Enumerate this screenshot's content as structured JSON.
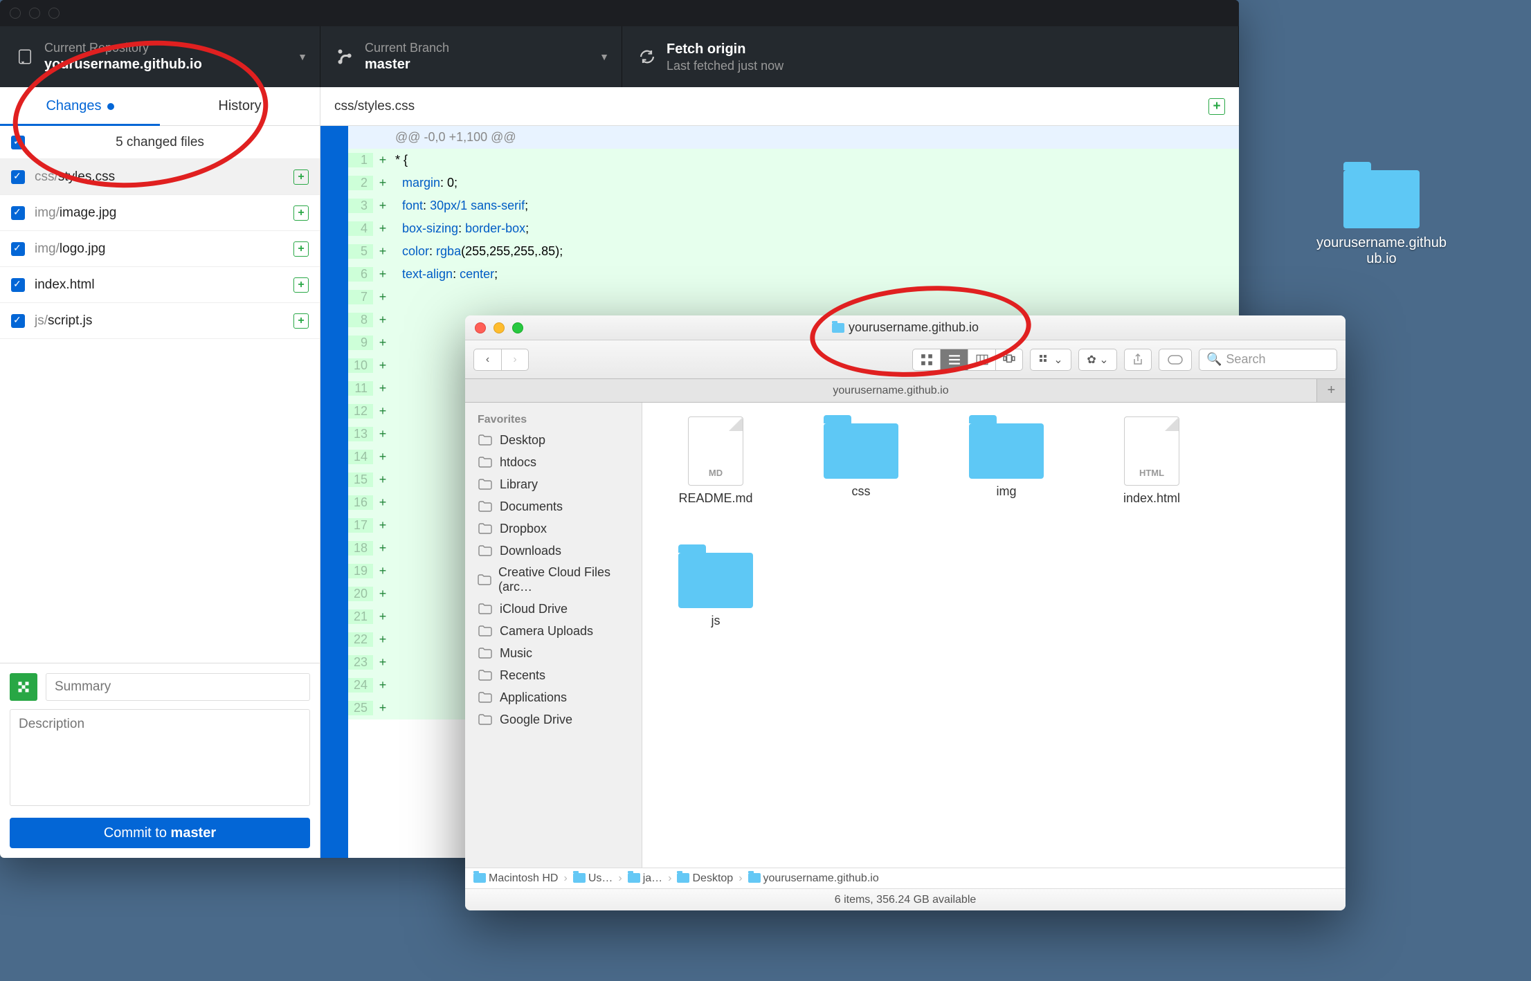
{
  "github": {
    "toolbar": {
      "repo_label": "Current Repository",
      "repo_value": "yourusername.github.io",
      "branch_label": "Current Branch",
      "branch_value": "master",
      "fetch_label": "Fetch origin",
      "fetch_sub": "Last fetched just now"
    },
    "tabs": {
      "changes": "Changes",
      "history": "History"
    },
    "file_count": "5 changed files",
    "files": [
      {
        "dir": "css/",
        "name": "styles.css",
        "selected": true
      },
      {
        "dir": "img/",
        "name": "image.jpg",
        "selected": false
      },
      {
        "dir": "img/",
        "name": "logo.jpg",
        "selected": false
      },
      {
        "dir": "",
        "name": "index.html",
        "selected": false
      },
      {
        "dir": "js/",
        "name": "script.js",
        "selected": false
      }
    ],
    "commit": {
      "summary_placeholder": "Summary",
      "desc_placeholder": "Description",
      "button_prefix": "Commit to ",
      "button_branch": "master"
    },
    "diff": {
      "filepath": "css/styles.css",
      "hunk": "@@ -0,0 +1,100 @@",
      "lines": [
        {
          "n": 1,
          "raw": "* {"
        },
        {
          "n": 2,
          "prop": "margin",
          "val": ": 0;"
        },
        {
          "n": 3,
          "prop": "font",
          "val2": "30px/1 sans-serif",
          "tail": ";"
        },
        {
          "n": 4,
          "prop": "box-sizing",
          "val2": "border-box",
          "tail": ";"
        },
        {
          "n": 5,
          "prop": "color",
          "func": "rgba",
          "args": "(255,255,255,.85)",
          "tail": ";"
        },
        {
          "n": 6,
          "prop": "text-align",
          "val2": "center",
          "tail": ";"
        }
      ],
      "trailing_nums": [
        7,
        8,
        9,
        10,
        11,
        12,
        13,
        14,
        15,
        16,
        17,
        18,
        19,
        20,
        21,
        22,
        23,
        24,
        25
      ]
    }
  },
  "finder": {
    "title": "yourusername.github.io",
    "tab": "yourusername.github.io",
    "search_placeholder": "Search",
    "sidebar_header": "Favorites",
    "sidebar": [
      "Desktop",
      "htdocs",
      "Library",
      "Documents",
      "Dropbox",
      "Downloads",
      "Creative Cloud Files (arc…",
      "iCloud Drive",
      "Camera Uploads",
      "Music",
      "Recents",
      "Applications",
      "Google Drive"
    ],
    "items": [
      {
        "name": "README.md",
        "type": "file",
        "badge": "MD"
      },
      {
        "name": "css",
        "type": "folder"
      },
      {
        "name": "img",
        "type": "folder"
      },
      {
        "name": "index.html",
        "type": "file",
        "badge": "HTML"
      },
      {
        "name": "js",
        "type": "folder"
      }
    ],
    "path": [
      "Macintosh HD",
      "Us…",
      "ja…",
      "Desktop",
      "yourusername.github.io"
    ],
    "status": "6 items, 356.24 GB available"
  },
  "desktop": {
    "folder_name": "yourusername.github\nub.io"
  }
}
